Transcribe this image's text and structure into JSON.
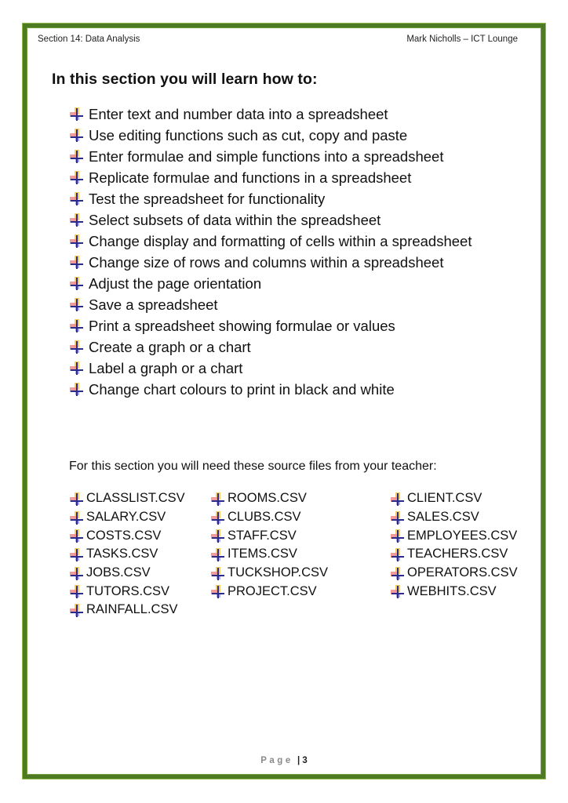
{
  "header": {
    "left": "Section 14: Data Analysis",
    "right": "Mark Nicholls – ICT Lounge"
  },
  "section_heading": "In this section you will learn how to:",
  "bullet_icon": "four-color-cross-bullet-icon",
  "objectives": [
    "Enter text and number data into a spreadsheet",
    "Use editing functions such as cut, copy and paste",
    "Enter formulae and simple functions into a spreadsheet",
    "Replicate formulae and functions in a spreadsheet",
    "Test the spreadsheet for functionality",
    "Select subsets of data within the spreadsheet",
    "Change display and formatting of cells within a spreadsheet",
    "Change size of rows and columns within a spreadsheet",
    "Adjust the page orientation",
    "Save a spreadsheet",
    "Print a spreadsheet showing formulae or values",
    "Create a graph or a chart",
    "Label a graph or a chart",
    "Change chart colours to print in black and white"
  ],
  "files_intro": "For this section you will need these source files from your teacher:",
  "files": {
    "column1": [
      "CLASSLIST.CSV",
      "SALARY.CSV",
      "COSTS.CSV",
      "TASKS.CSV",
      "JOBS.CSV",
      "TUTORS.CSV",
      "RAINFALL.CSV"
    ],
    "column2": [
      "ROOMS.CSV",
      "CLUBS.CSV",
      "STAFF.CSV",
      "ITEMS.CSV",
      "TUCKSHOP.CSV",
      "PROJECT.CSV"
    ],
    "column3": [
      "CLIENT.CSV",
      "SALES.CSV",
      "EMPLOYEES.CSV",
      "TEACHERS.CSV",
      "OPERATORS.CSV",
      "WEBHITS.CSV"
    ]
  },
  "footer": {
    "page_word": "Page",
    "separator": "|",
    "page_number": "3"
  },
  "colors": {
    "border": "#4d7a23",
    "border_highlight": "#8fbf4a"
  }
}
